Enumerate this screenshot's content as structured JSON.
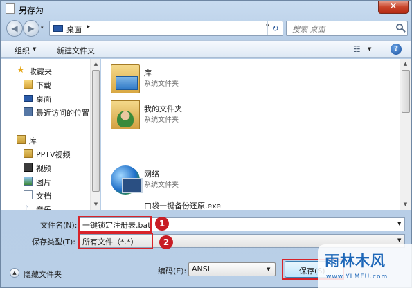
{
  "window": {
    "title": "另存为",
    "close_glyph": "✕"
  },
  "address": {
    "location": "桌面",
    "separator_glyph": "▸",
    "dropdown_glyph": "▾",
    "refresh_glyph": "↻"
  },
  "navigation": {
    "back_glyph": "◀",
    "forward_glyph": "▶",
    "recent_glyph": "▾"
  },
  "search": {
    "placeholder": "搜索 桌面"
  },
  "toolbar": {
    "organize_label": "组织",
    "organize_arrow": "▼",
    "new_folder_label": "新建文件夹",
    "view_glyph": "☷",
    "view_arrow": "▼",
    "help_glyph": "?"
  },
  "sidebar": {
    "items": [
      {
        "label": "收藏夹",
        "icon": "star-icon"
      },
      {
        "label": "下载",
        "icon": "downloads-icon"
      },
      {
        "label": "桌面",
        "icon": "desktop-icon"
      },
      {
        "label": "最近访问的位置",
        "icon": "recent-places-icon"
      },
      {
        "label": "库",
        "icon": "library-icon"
      },
      {
        "label": "PPTV视频",
        "icon": "video-folder-icon"
      },
      {
        "label": "视频",
        "icon": "videos-icon"
      },
      {
        "label": "图片",
        "icon": "pictures-icon"
      },
      {
        "label": "文档",
        "icon": "documents-icon"
      },
      {
        "label": "音乐",
        "icon": "music-icon"
      }
    ],
    "star_glyph": "★",
    "music_glyph": "♪"
  },
  "files": [
    {
      "name": "库",
      "type": "系统文件夹",
      "icon": "library-folder-icon"
    },
    {
      "name": "我的文件夹",
      "type": "系统文件夹",
      "icon": "user-folder-icon"
    },
    {
      "name": "网络",
      "type": "系统文件夹",
      "icon": "network-icon"
    },
    {
      "name": "口袋一键备份还原.exe",
      "type": "",
      "icon": "exe-file-icon"
    }
  ],
  "scroll": {
    "up_glyph": "▲",
    "down_glyph": "▼"
  },
  "form": {
    "filename_label": "文件名(N):",
    "filename_value": "一键锁定注册表.bat",
    "filetype_label": "保存类型(T):",
    "filetype_value": "所有文件（*.*）",
    "dropdown_glyph": "▼",
    "marker_1": "1",
    "marker_2": "2"
  },
  "footer": {
    "hide_folders_label": "隐藏文件夹",
    "hide_glyph": "▲",
    "encoding_label": "编码(E):",
    "encoding_value": "ANSI",
    "encoding_glyph": "▼",
    "save_label": "保存(S)"
  },
  "watermark": {
    "text": "雨林木风",
    "url": "www.YLMFU.com"
  },
  "colors": {
    "highlight": "#d8232a",
    "accent": "#1d67b8"
  }
}
